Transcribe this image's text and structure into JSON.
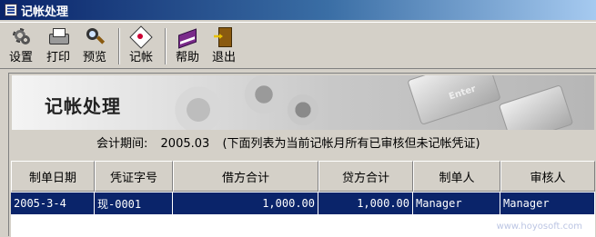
{
  "window": {
    "title": "记帐处理"
  },
  "toolbar": {
    "buttons": [
      {
        "label": "设置",
        "icon": "gear-icon"
      },
      {
        "label": "打印",
        "icon": "printer-icon"
      },
      {
        "label": "预览",
        "icon": "magnifier-icon"
      },
      {
        "label": "记帐",
        "icon": "post-icon"
      },
      {
        "label": "帮助",
        "icon": "book-icon"
      },
      {
        "label": "退出",
        "icon": "door-exit-icon"
      }
    ]
  },
  "banner": {
    "title": "记帐处理",
    "key_label": "Enter"
  },
  "period": {
    "label": "会计期间:",
    "value": "2005.03",
    "note": "(下面列表为当前记帐月所有已审核但未记帐凭证)"
  },
  "table": {
    "columns": [
      "制单日期",
      "凭证字号",
      "借方合计",
      "贷方合计",
      "制单人",
      "审核人"
    ],
    "rows": [
      [
        "2005-3-4",
        "现-0001",
        "1,000.00",
        "1,000.00",
        "Manager",
        "Manager"
      ]
    ]
  },
  "watermark": "www.hoyosoft.com"
}
